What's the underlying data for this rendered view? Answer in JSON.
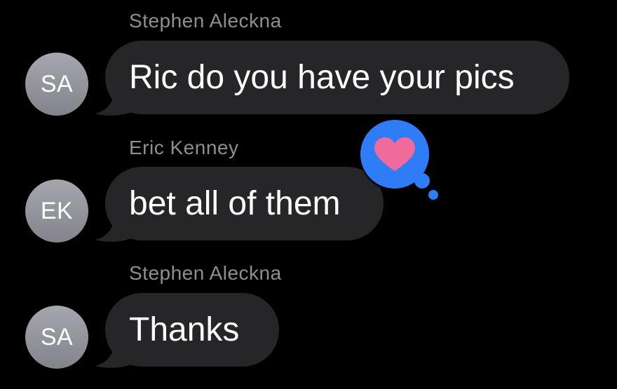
{
  "colors": {
    "background": "#000000",
    "bubble": "#262628",
    "sender_name": "#8e8e93",
    "avatar": "#9a9ba2",
    "tapback_blue": "#2e7cf6",
    "heart_pink": "#f06a9b"
  },
  "messages": [
    {
      "sender": "Stephen Aleckna",
      "initials": "SA",
      "text": "Ric do you have your pics"
    },
    {
      "sender": "Eric Kenney",
      "initials": "EK",
      "text": "bet all of them",
      "tapback_icon": "heart-icon"
    },
    {
      "sender": "Stephen Aleckna",
      "initials": "SA",
      "text": "Thanks"
    }
  ]
}
